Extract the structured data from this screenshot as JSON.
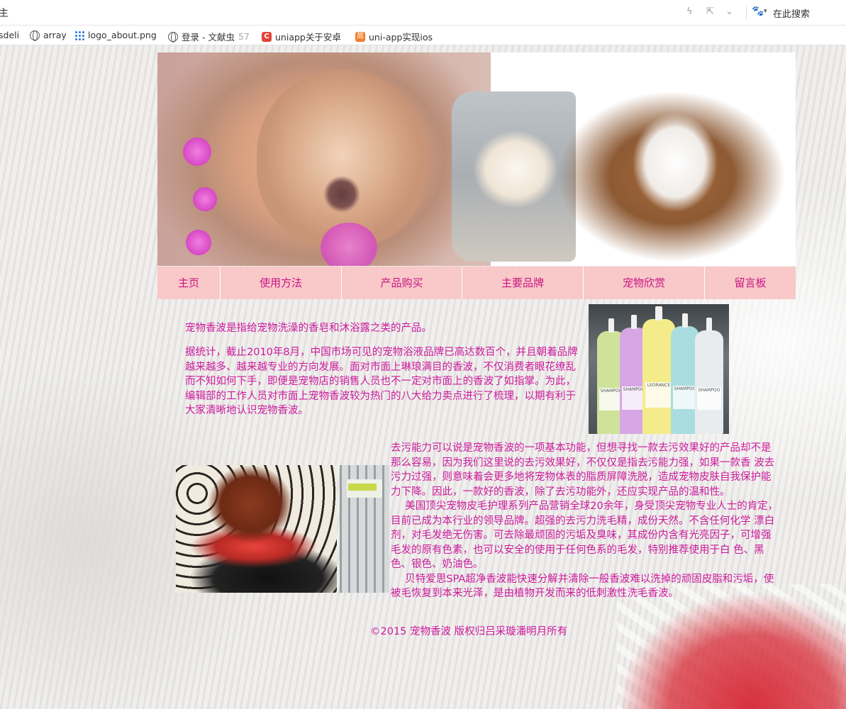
{
  "browser": {
    "left_fragment": "主",
    "search_label": "在此搜索",
    "bookmarks": [
      {
        "label": "sdeli",
        "icon": "text"
      },
      {
        "label": "array",
        "icon": "globe-icon"
      },
      {
        "label": "logo_about.png",
        "icon": "grid-icon"
      },
      {
        "label": "登录 - 文献虫",
        "extra": "57",
        "icon": "globe-icon"
      },
      {
        "label": "uniapp关于安卓",
        "icon": "c-logo-icon"
      },
      {
        "label": "uni-app实现ios",
        "icon": "jian-icon"
      }
    ]
  },
  "nav": {
    "items": [
      {
        "label": "主页"
      },
      {
        "label": "使用方法"
      },
      {
        "label": "产品购买"
      },
      {
        "label": "主要品牌"
      },
      {
        "label": "宠物欣赏"
      },
      {
        "label": "留言板"
      }
    ]
  },
  "content": {
    "intro": "宠物香波是指给宠物洗澡的香皂和沐浴露之类的产品。",
    "stats": "据统计，截止2010年8月，中国市场可见的宠物浴液品牌已高达数百个，并且朝着品牌越来越多、越来越专业的方向发展。面对市面上琳琅满目的香波，不仅消费者眼花缭乱而不知如何下手，即便是宠物店的销售人员也不一定对市面上的香波了如指掌。为此，编辑部的工作人员对市面上宠物香波较为热门的八大给力卖点进行了梳理，以期有利于大家清晰地认识宠物香波。",
    "detail_1": "去污能力可以说是宠物香波的一项基本功能，但想寻找一款去污效果好的产品却不是那么容易，因为我们这里说的去污效果好，不仅仅是指去污能力强，如果一款香 波去污力过强，则意味着会更多地将宠物体表的脂质屏障洗脱，造成宠物皮肤自我保护能力下降。因此，一款好的香波，除了去污功能外，还应实现产品的温和性。",
    "detail_2": "美国顶尖宠物皮毛护理系列产品营销全球20余年，身受顶尖宠物专业人士的肯定，目前已成为本行业的领导品牌。超强的去污力洗毛精，成份天然。不含任何化学 漂白剂，对毛发绝无伤害。可去除最顽固的污垢及臭味，其成份内含有光亮因子，可增强毛发的原有色素，也可以安全的使用于任何色系的毛发，特别推荐使用于白 色、黑色、银色、奶油色。",
    "detail_3": "贝特爱思SPA超净香波能快速分解并清除一般香波难以洗掉的顽固皮脂和污垢，使被毛恢复到本来光泽，是由植物开发而来的低刺激性洗毛香波。"
  },
  "footer": {
    "text": "©2015 宠物香波 版权归吕采璇潘明月所有"
  },
  "images": {
    "shampoo_brand": "LEORANCE",
    "shampoo_label": "SHAMPOO"
  },
  "colors": {
    "text_accent": "#cc1a9c",
    "nav_bg": "#f9c8c8"
  }
}
